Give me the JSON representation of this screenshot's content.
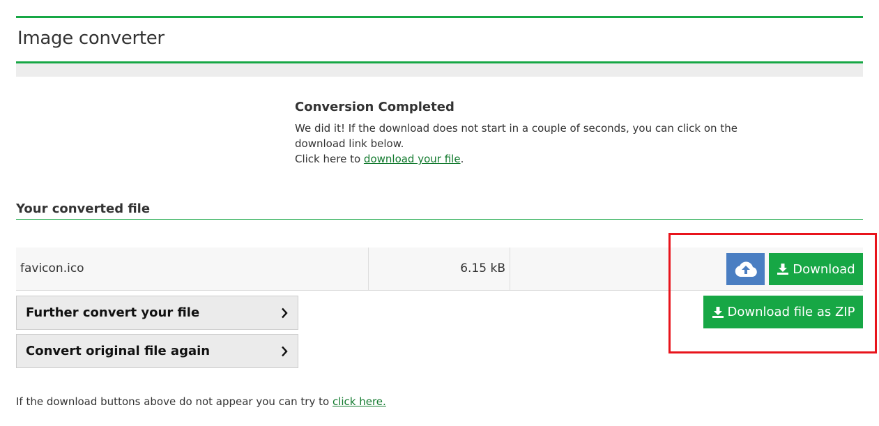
{
  "header": {
    "title": "Image converter"
  },
  "completion": {
    "title": "Conversion Completed",
    "message": "We did it! If the download does not start in a couple of seconds, you can click on the download link below.",
    "click_prefix": "Click here to",
    "click_link": "download your file",
    "click_suffix": "."
  },
  "converted": {
    "section_title": "Your converted file",
    "file_name": "favicon.ico",
    "file_size": "6.15 kB",
    "upload_icon": "cloud-upload-icon",
    "download_label": "Download",
    "download_zip_label": "Download file as ZIP"
  },
  "actions": [
    {
      "label": "Further convert your file"
    },
    {
      "label": "Convert original file again"
    }
  ],
  "footer": {
    "prefix": "If the download buttons above do not appear you can try to",
    "link": "click here."
  },
  "colors": {
    "accent_green": "#17a745",
    "upload_blue": "#4a7ec2",
    "highlight_red": "#e8141c",
    "link_green": "#127a2e"
  }
}
